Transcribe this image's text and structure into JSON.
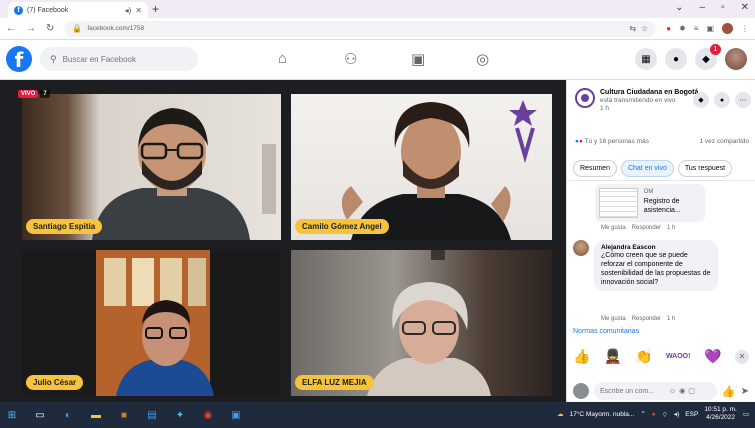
{
  "browser": {
    "tab_title": "(7) Facebook",
    "url": "facebook.com/1758"
  },
  "facebook": {
    "search_placeholder": "Buscar en Facebook",
    "notif_count": "1"
  },
  "video": {
    "live_label": "VIVO",
    "viewer_count": "7",
    "participants": [
      {
        "name": "Santiago Espitia"
      },
      {
        "name": "Camilo Gómez Angel"
      },
      {
        "name": "Julio César"
      },
      {
        "name": "ELFA LUZ MEJIA"
      }
    ]
  },
  "sidebar": {
    "page_name": "Cultura Ciudadana en Bogotá",
    "status": "está transmitiendo en vivo",
    "time": "1 h",
    "reactions": "Tú y 18 personas más",
    "shares": "1 vez compartido",
    "tabs": [
      {
        "label": "Resumen"
      },
      {
        "label": "Chat en vivo"
      },
      {
        "label": "Tus respuest"
      }
    ],
    "attachment": {
      "caption_line1": "OM",
      "caption_line2": "Registro de asistencia..."
    },
    "actions": {
      "like": "Me gusta",
      "reply": "Responder",
      "time": "1 h"
    },
    "comment": {
      "author": "Alejandra Eascon",
      "text": "¿Cómo creen que se puede reforzar el componente de sostenibilidad de las propuestas de innovación social?"
    },
    "normas": "Normas comunitarias",
    "comment_placeholder": "Escribe un com...",
    "emoji_sticker": "WAOO!"
  },
  "taskbar": {
    "weather": "17°C Mayorm. nubla...",
    "lang": "ESP",
    "time": "10:51 p. m.",
    "date": "4/26/2022"
  }
}
